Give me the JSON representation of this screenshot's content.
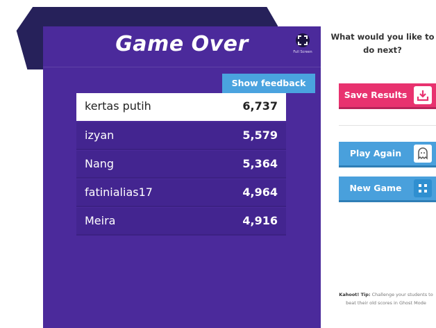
{
  "header": {
    "title": "Game Over",
    "fullscreen_label": "Full Screen"
  },
  "feedback_button": "Show feedback",
  "leaderboard": [
    {
      "name": "kertas putih",
      "score": "6,737"
    },
    {
      "name": "izyan",
      "score": "5,579"
    },
    {
      "name": "Nang",
      "score": "5,364"
    },
    {
      "name": "fatinialias17",
      "score": "4,964"
    },
    {
      "name": "Meira",
      "score": "4,916"
    }
  ],
  "sidebar": {
    "question": "What would you like to do next?",
    "save_results": "Save Results",
    "play_again": "Play Again",
    "new_game": "New Game",
    "tip_label": "Kahoot! Tip:",
    "tip_text": "Challenge your students to beat their old scores in Ghost Mode"
  },
  "colors": {
    "panel": "#4b2a9b",
    "backdrop": "#26215a",
    "save": "#e8326f",
    "blue": "#49a0dc"
  },
  "icons": {
    "fullscreen": "fullscreen-icon",
    "save": "download-icon",
    "play_again": "ghost-icon",
    "new_game": "grid-icon"
  }
}
